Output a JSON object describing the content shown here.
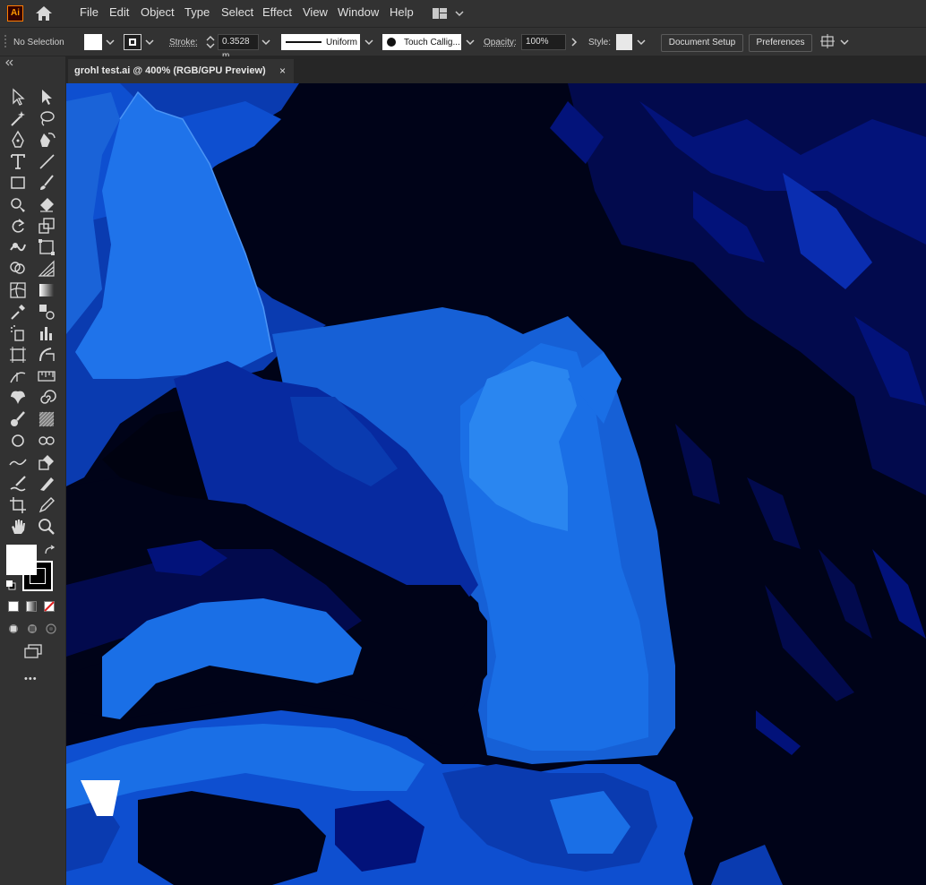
{
  "app": {
    "logo_text": "Ai",
    "logo_color": "#ff9a00"
  },
  "menu": {
    "items": [
      "File",
      "Edit",
      "Object",
      "Type",
      "Select",
      "Effect",
      "View",
      "Window",
      "Help"
    ]
  },
  "control_bar": {
    "selection_label": "No Selection",
    "fill_color": "#ffffff",
    "stroke_label": "Stroke:",
    "stroke_weight": "0.3528 m",
    "stroke_profile": "Uniform",
    "brush": "Touch Callig...",
    "opacity_label": "Opacity:",
    "opacity_value": "100%",
    "style_label": "Style:",
    "document_setup": "Document Setup",
    "preferences": "Preferences"
  },
  "document": {
    "tab_title": "grohl test.ai @ 400% (RGB/GPU Preview)",
    "close_glyph": "×"
  },
  "toolbar": {
    "fill_color": "#ffffff",
    "stroke_color": "#000000",
    "more_glyph": "•••",
    "tools": [
      "selection-tool",
      "direct-selection-tool",
      "magic-wand-tool",
      "lasso-tool",
      "pen-tool",
      "curvature-tool",
      "type-tool",
      "line-segment-tool",
      "rectangle-tool",
      "paintbrush-tool",
      "shaper-tool",
      "eraser-tool",
      "rotate-tool",
      "scale-tool",
      "warp-tool",
      "free-transform-tool",
      "shape-builder-tool",
      "perspective-grid-tool",
      "mesh-tool",
      "gradient-tool",
      "eyedropper-tool",
      "blend-tool",
      "symbol-sprayer-tool",
      "column-graph-tool",
      "artboard-tool",
      "slice-tool",
      "width-tool",
      "measure-tool",
      "puppet-warp-tool",
      "spiral-tool",
      "brush-tool-2",
      "pattern-tool",
      "ellipse-tool",
      "ellipse-group-tool",
      "smooth-tool",
      "live-paint-bucket-tool",
      "blob-brush-tool",
      "knife-tool",
      "crop-tool",
      "pencil-tool",
      "hand-tool",
      "zoom-tool"
    ]
  },
  "colors": {
    "ui_bg": "#323232",
    "canvas_dark": "#000318",
    "navy": "#02127a",
    "mid_blue": "#0a3bb0",
    "bright_blue": "#1a6fe6",
    "light_blue": "#2a86f0"
  }
}
